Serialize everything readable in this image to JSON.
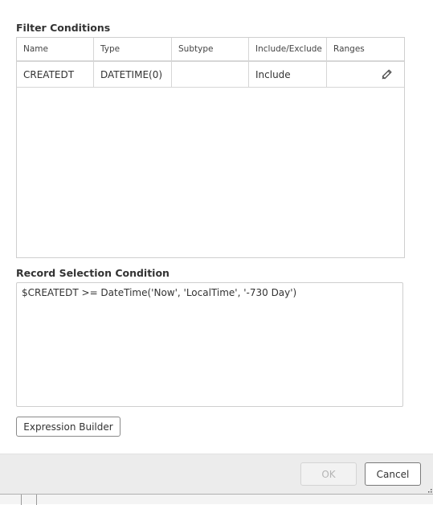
{
  "filter_conditions": {
    "title": "Filter Conditions",
    "columns": [
      "Name",
      "Type",
      "Subtype",
      "Include/Exclude",
      "Ranges"
    ],
    "rows": [
      {
        "name": "CREATEDT",
        "type": "DATETIME(0)",
        "subtype": "",
        "include_exclude": "Include",
        "ranges_icon": "pencil-icon"
      }
    ]
  },
  "record_selection": {
    "title": "Record Selection Condition",
    "value": "$CREATEDT >= DateTime('Now', 'LocalTime', '-730 Day')"
  },
  "buttons": {
    "expression_builder": "Expression Builder",
    "ok": "OK",
    "cancel": "Cancel"
  },
  "colors": {
    "footer_bg": "#ececec",
    "border": "#cfcfcf",
    "disabled_text": "#b5b5b5"
  }
}
